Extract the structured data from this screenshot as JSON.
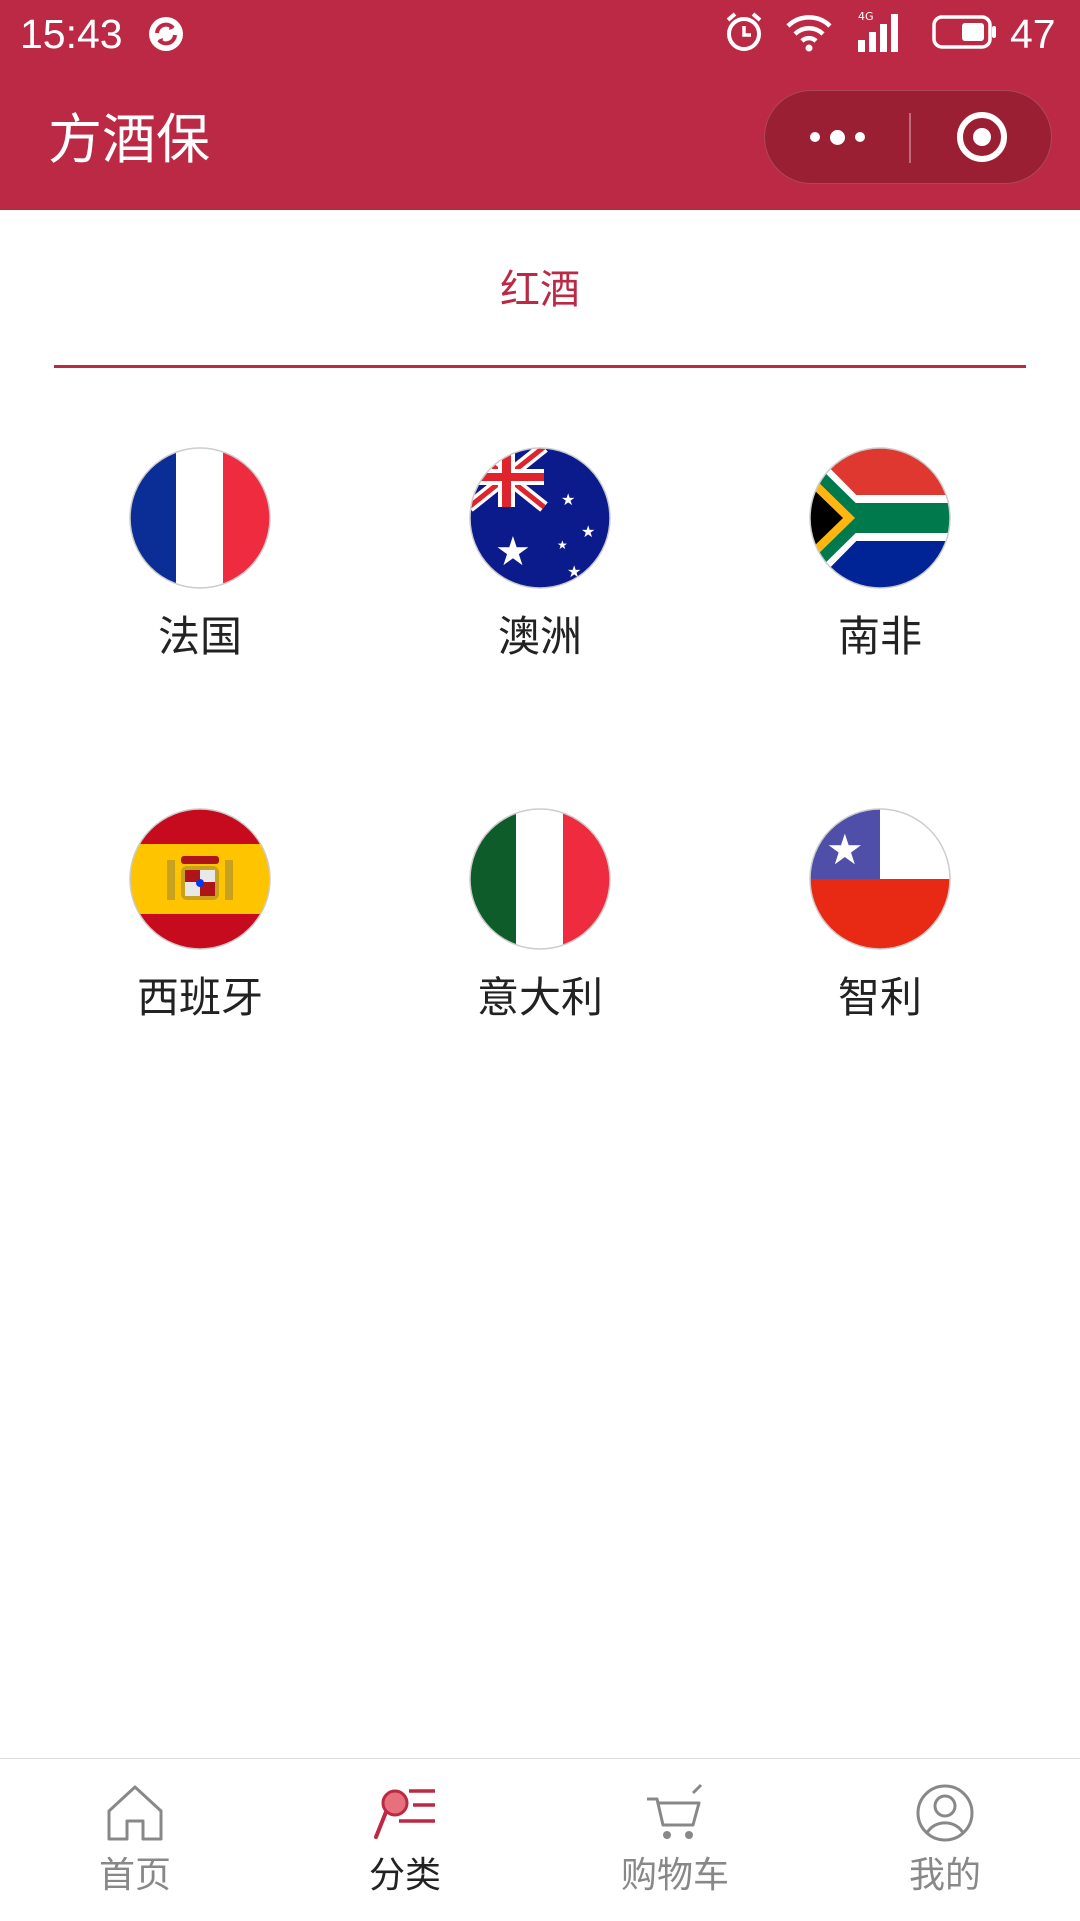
{
  "status_bar": {
    "time": "15:43",
    "battery_level": "47",
    "network": "4G",
    "icons": [
      "sync-icon",
      "alarm-icon",
      "wifi-icon",
      "signal-icon",
      "battery-icon"
    ]
  },
  "header": {
    "title": "方酒保",
    "background_color": "#bb2944",
    "more_icon": "more-dots-icon",
    "close_icon": "target-close-icon"
  },
  "category": {
    "tab_label": "红酒",
    "accent_color": "#bb2944"
  },
  "countries": [
    {
      "name": "法国",
      "flag": "france-flag-icon"
    },
    {
      "name": "澳洲",
      "flag": "australia-flag-icon"
    },
    {
      "name": "南非",
      "flag": "south-africa-flag-icon"
    },
    {
      "name": "西班牙",
      "flag": "spain-flag-icon"
    },
    {
      "name": "意大利",
      "flag": "italy-flag-icon"
    },
    {
      "name": "智利",
      "flag": "chile-flag-icon"
    }
  ],
  "tabbar": {
    "items": [
      {
        "label": "首页",
        "icon": "home-icon",
        "active": false
      },
      {
        "label": "分类",
        "icon": "category-icon",
        "active": true
      },
      {
        "label": "购物车",
        "icon": "cart-icon",
        "active": false
      },
      {
        "label": "我的",
        "icon": "profile-icon",
        "active": false
      }
    ]
  }
}
